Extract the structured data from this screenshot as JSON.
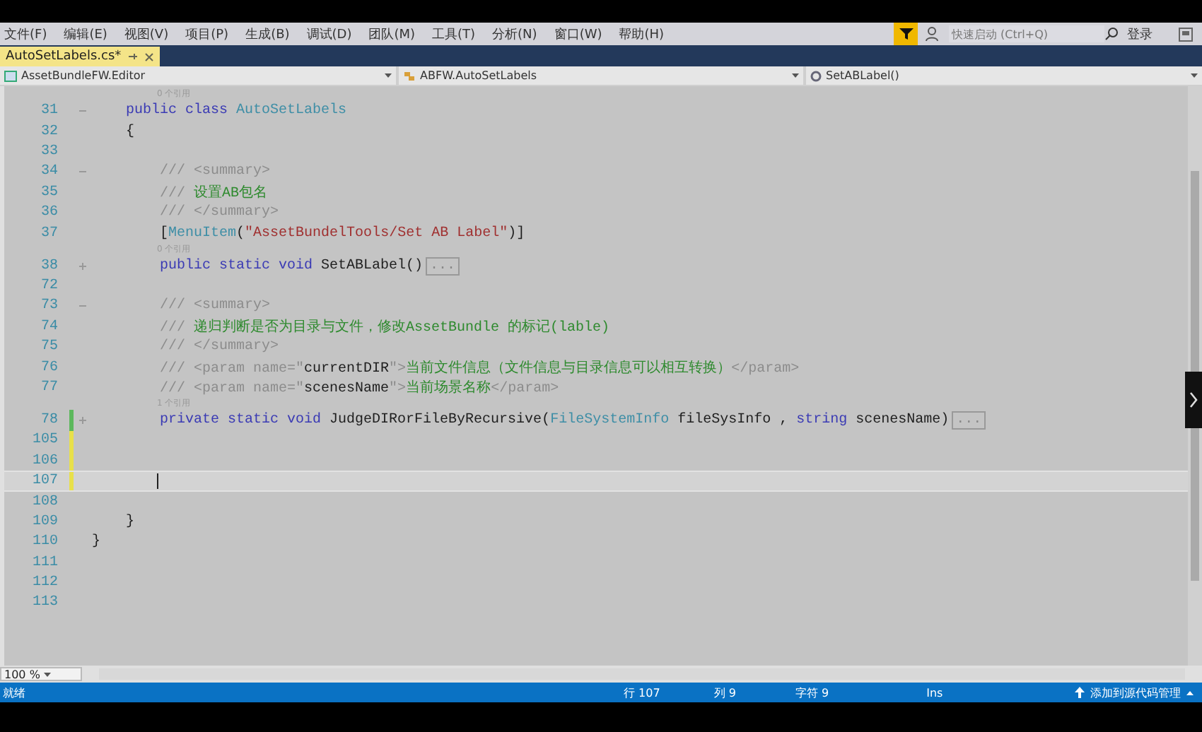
{
  "menu": [
    "文件(F)",
    "编辑(E)",
    "视图(V)",
    "项目(P)",
    "生成(B)",
    "调试(D)",
    "团队(M)",
    "工具(T)",
    "分析(N)",
    "窗口(W)",
    "帮助(H)"
  ],
  "quick_launch": {
    "placeholder": "快速启动 (Ctrl+Q)"
  },
  "login": "登录",
  "tabs": [
    {
      "label": "AutoSetLabels.cs*",
      "selected": true
    }
  ],
  "nav": [
    "AssetBundleFW.Editor",
    "ABFW.AutoSetLabels",
    "SetABLabel()"
  ],
  "lines": [
    {
      "number": "31",
      "expanded": true,
      "modified": false,
      "current": false,
      "codelens": "0 个引用",
      "tokens": [
        {
          "text": "    public class ",
          "kind": "keyword"
        },
        {
          "text": "AutoSetLabels",
          "kind": "type"
        }
      ]
    },
    {
      "number": "32",
      "modified": false,
      "current": false,
      "tokens": [
        {
          "text": "    {",
          "kind": "plain"
        }
      ]
    },
    {
      "number": "33",
      "modified": false,
      "current": false
    },
    {
      "number": "34",
      "expanded": true,
      "modified": false,
      "current": false,
      "tokens": [
        {
          "text": "        /// <summary>",
          "kind": "xmldoc"
        }
      ]
    },
    {
      "number": "35",
      "modified": false,
      "current": false,
      "tokens": [
        {
          "text": "        /// ",
          "kind": "xmldoc"
        },
        {
          "text": "设置AB包名",
          "kind": "comment"
        }
      ]
    },
    {
      "number": "36",
      "modified": false,
      "current": false,
      "tokens": [
        {
          "text": "        /// </summary>",
          "kind": "xmldoc"
        }
      ]
    },
    {
      "number": "37",
      "modified": false,
      "current": false,
      "tokens": [
        {
          "text": "        [",
          "kind": "plain"
        },
        {
          "text": "MenuItem",
          "kind": "type"
        },
        {
          "text": "(",
          "kind": "plain"
        },
        {
          "text": "\"AssetBundelTools/Set AB Label\"",
          "kind": "string"
        },
        {
          "text": ")]",
          "kind": "plain"
        }
      ]
    },
    {
      "number": "38",
      "expanded": false,
      "modified": false,
      "current": false,
      "codelens": "0 个引用",
      "tokens": [
        {
          "text": "        public static void ",
          "kind": "keyword"
        },
        {
          "text": "SetABLabel()",
          "kind": "plain"
        },
        {
          "text": "...",
          "kind": "collapsed"
        }
      ]
    },
    {
      "number": "72",
      "modified": false,
      "current": false
    },
    {
      "number": "73",
      "expanded": true,
      "modified": false,
      "current": false,
      "tokens": [
        {
          "text": "        /// <summary>",
          "kind": "xmldoc"
        }
      ]
    },
    {
      "number": "74",
      "modified": false,
      "current": false,
      "tokens": [
        {
          "text": "        /// ",
          "kind": "xmldoc"
        },
        {
          "text": "递归判断是否为目录与文件，修改AssetBundle 的标记(lable)",
          "kind": "comment"
        }
      ]
    },
    {
      "number": "75",
      "modified": false,
      "current": false,
      "tokens": [
        {
          "text": "        /// </summary>",
          "kind": "xmldoc"
        }
      ]
    },
    {
      "number": "76",
      "modified": false,
      "current": false,
      "tokens": [
        {
          "text": "        /// <param name=\"",
          "kind": "xmldoc"
        },
        {
          "text": "currentDIR",
          "kind": "plain"
        },
        {
          "text": "\">",
          "kind": "xmldoc"
        },
        {
          "text": "当前文件信息（文件信息与目录信息可以相互转换）",
          "kind": "comment"
        },
        {
          "text": "</param>",
          "kind": "xmldoc"
        }
      ]
    },
    {
      "number": "77",
      "modified": false,
      "current": false,
      "tokens": [
        {
          "text": "        /// <param name=\"",
          "kind": "xmldoc"
        },
        {
          "text": "scenesName",
          "kind": "plain"
        },
        {
          "text": "\">",
          "kind": "xmldoc"
        },
        {
          "text": "当前场景名称",
          "kind": "comment"
        },
        {
          "text": "</param>",
          "kind": "xmldoc"
        }
      ]
    },
    {
      "number": "78",
      "expanded": false,
      "modified": true,
      "saved": true,
      "current": false,
      "codelens": "1 个引用",
      "tokens": [
        {
          "text": "        private static void ",
          "kind": "keyword"
        },
        {
          "text": "JudgeDIRorFileByRecursive(",
          "kind": "plain"
        },
        {
          "text": "FileSystemInfo",
          "kind": "type"
        },
        {
          "text": " fileSysInfo , ",
          "kind": "plain"
        },
        {
          "text": "string",
          "kind": "keyword"
        },
        {
          "text": " scenesName)",
          "kind": "plain"
        },
        {
          "text": "...",
          "kind": "collapsed"
        }
      ]
    },
    {
      "number": "105",
      "modified": true,
      "saved": false,
      "current": false
    },
    {
      "number": "106",
      "modified": true,
      "saved": false,
      "current": false
    },
    {
      "number": "107",
      "modified": true,
      "saved": false,
      "current": true
    },
    {
      "number": "108",
      "modified": false,
      "current": false
    },
    {
      "number": "109",
      "modified": false,
      "current": false,
      "tokens": [
        {
          "text": "    }",
          "kind": "plain"
        }
      ]
    },
    {
      "number": "110",
      "modified": false,
      "current": false,
      "tokens": [
        {
          "text": "}",
          "kind": "plain"
        }
      ]
    },
    {
      "number": "111",
      "modified": false,
      "current": false
    },
    {
      "number": "112",
      "modified": false,
      "current": false
    },
    {
      "number": "113",
      "modified": false,
      "current": false
    }
  ],
  "zoom": "100 %",
  "status": {
    "ready": "就绪",
    "line": "行 107",
    "column": "列 9",
    "char": "字符 9",
    "mode": "Ins",
    "source_control": "添加到源代码管理"
  }
}
